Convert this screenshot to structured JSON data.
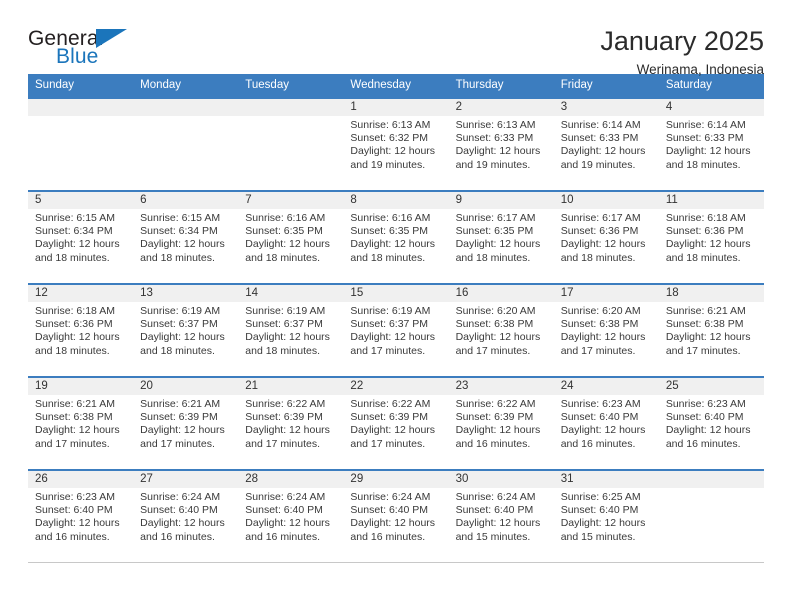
{
  "brand": {
    "name_top": "General",
    "name_bottom": "Blue",
    "accent_color": "#1b75bb",
    "triangle_icon": "triangle-icon"
  },
  "header": {
    "title": "January 2025",
    "location": "Werinama, Indonesia"
  },
  "theme": {
    "header_blue": "#3c7dbf",
    "daynum_band": "#f0f0f0",
    "text": "#3a3a3a"
  },
  "weekday_headers": [
    "Sunday",
    "Monday",
    "Tuesday",
    "Wednesday",
    "Thursday",
    "Friday",
    "Saturday"
  ],
  "weeks": [
    [
      {
        "day": "",
        "lines": []
      },
      {
        "day": "",
        "lines": []
      },
      {
        "day": "",
        "lines": []
      },
      {
        "day": "1",
        "lines": [
          "Sunrise: 6:13 AM",
          "Sunset: 6:32 PM",
          "Daylight: 12 hours",
          "and 19 minutes."
        ]
      },
      {
        "day": "2",
        "lines": [
          "Sunrise: 6:13 AM",
          "Sunset: 6:33 PM",
          "Daylight: 12 hours",
          "and 19 minutes."
        ]
      },
      {
        "day": "3",
        "lines": [
          "Sunrise: 6:14 AM",
          "Sunset: 6:33 PM",
          "Daylight: 12 hours",
          "and 19 minutes."
        ]
      },
      {
        "day": "4",
        "lines": [
          "Sunrise: 6:14 AM",
          "Sunset: 6:33 PM",
          "Daylight: 12 hours",
          "and 18 minutes."
        ]
      }
    ],
    [
      {
        "day": "5",
        "lines": [
          "Sunrise: 6:15 AM",
          "Sunset: 6:34 PM",
          "Daylight: 12 hours",
          "and 18 minutes."
        ]
      },
      {
        "day": "6",
        "lines": [
          "Sunrise: 6:15 AM",
          "Sunset: 6:34 PM",
          "Daylight: 12 hours",
          "and 18 minutes."
        ]
      },
      {
        "day": "7",
        "lines": [
          "Sunrise: 6:16 AM",
          "Sunset: 6:35 PM",
          "Daylight: 12 hours",
          "and 18 minutes."
        ]
      },
      {
        "day": "8",
        "lines": [
          "Sunrise: 6:16 AM",
          "Sunset: 6:35 PM",
          "Daylight: 12 hours",
          "and 18 minutes."
        ]
      },
      {
        "day": "9",
        "lines": [
          "Sunrise: 6:17 AM",
          "Sunset: 6:35 PM",
          "Daylight: 12 hours",
          "and 18 minutes."
        ]
      },
      {
        "day": "10",
        "lines": [
          "Sunrise: 6:17 AM",
          "Sunset: 6:36 PM",
          "Daylight: 12 hours",
          "and 18 minutes."
        ]
      },
      {
        "day": "11",
        "lines": [
          "Sunrise: 6:18 AM",
          "Sunset: 6:36 PM",
          "Daylight: 12 hours",
          "and 18 minutes."
        ]
      }
    ],
    [
      {
        "day": "12",
        "lines": [
          "Sunrise: 6:18 AM",
          "Sunset: 6:36 PM",
          "Daylight: 12 hours",
          "and 18 minutes."
        ]
      },
      {
        "day": "13",
        "lines": [
          "Sunrise: 6:19 AM",
          "Sunset: 6:37 PM",
          "Daylight: 12 hours",
          "and 18 minutes."
        ]
      },
      {
        "day": "14",
        "lines": [
          "Sunrise: 6:19 AM",
          "Sunset: 6:37 PM",
          "Daylight: 12 hours",
          "and 18 minutes."
        ]
      },
      {
        "day": "15",
        "lines": [
          "Sunrise: 6:19 AM",
          "Sunset: 6:37 PM",
          "Daylight: 12 hours",
          "and 17 minutes."
        ]
      },
      {
        "day": "16",
        "lines": [
          "Sunrise: 6:20 AM",
          "Sunset: 6:38 PM",
          "Daylight: 12 hours",
          "and 17 minutes."
        ]
      },
      {
        "day": "17",
        "lines": [
          "Sunrise: 6:20 AM",
          "Sunset: 6:38 PM",
          "Daylight: 12 hours",
          "and 17 minutes."
        ]
      },
      {
        "day": "18",
        "lines": [
          "Sunrise: 6:21 AM",
          "Sunset: 6:38 PM",
          "Daylight: 12 hours",
          "and 17 minutes."
        ]
      }
    ],
    [
      {
        "day": "19",
        "lines": [
          "Sunrise: 6:21 AM",
          "Sunset: 6:38 PM",
          "Daylight: 12 hours",
          "and 17 minutes."
        ]
      },
      {
        "day": "20",
        "lines": [
          "Sunrise: 6:21 AM",
          "Sunset: 6:39 PM",
          "Daylight: 12 hours",
          "and 17 minutes."
        ]
      },
      {
        "day": "21",
        "lines": [
          "Sunrise: 6:22 AM",
          "Sunset: 6:39 PM",
          "Daylight: 12 hours",
          "and 17 minutes."
        ]
      },
      {
        "day": "22",
        "lines": [
          "Sunrise: 6:22 AM",
          "Sunset: 6:39 PM",
          "Daylight: 12 hours",
          "and 17 minutes."
        ]
      },
      {
        "day": "23",
        "lines": [
          "Sunrise: 6:22 AM",
          "Sunset: 6:39 PM",
          "Daylight: 12 hours",
          "and 16 minutes."
        ]
      },
      {
        "day": "24",
        "lines": [
          "Sunrise: 6:23 AM",
          "Sunset: 6:40 PM",
          "Daylight: 12 hours",
          "and 16 minutes."
        ]
      },
      {
        "day": "25",
        "lines": [
          "Sunrise: 6:23 AM",
          "Sunset: 6:40 PM",
          "Daylight: 12 hours",
          "and 16 minutes."
        ]
      }
    ],
    [
      {
        "day": "26",
        "lines": [
          "Sunrise: 6:23 AM",
          "Sunset: 6:40 PM",
          "Daylight: 12 hours",
          "and 16 minutes."
        ]
      },
      {
        "day": "27",
        "lines": [
          "Sunrise: 6:24 AM",
          "Sunset: 6:40 PM",
          "Daylight: 12 hours",
          "and 16 minutes."
        ]
      },
      {
        "day": "28",
        "lines": [
          "Sunrise: 6:24 AM",
          "Sunset: 6:40 PM",
          "Daylight: 12 hours",
          "and 16 minutes."
        ]
      },
      {
        "day": "29",
        "lines": [
          "Sunrise: 6:24 AM",
          "Sunset: 6:40 PM",
          "Daylight: 12 hours",
          "and 16 minutes."
        ]
      },
      {
        "day": "30",
        "lines": [
          "Sunrise: 6:24 AM",
          "Sunset: 6:40 PM",
          "Daylight: 12 hours",
          "and 15 minutes."
        ]
      },
      {
        "day": "31",
        "lines": [
          "Sunrise: 6:25 AM",
          "Sunset: 6:40 PM",
          "Daylight: 12 hours",
          "and 15 minutes."
        ]
      },
      {
        "day": "",
        "lines": []
      }
    ]
  ]
}
